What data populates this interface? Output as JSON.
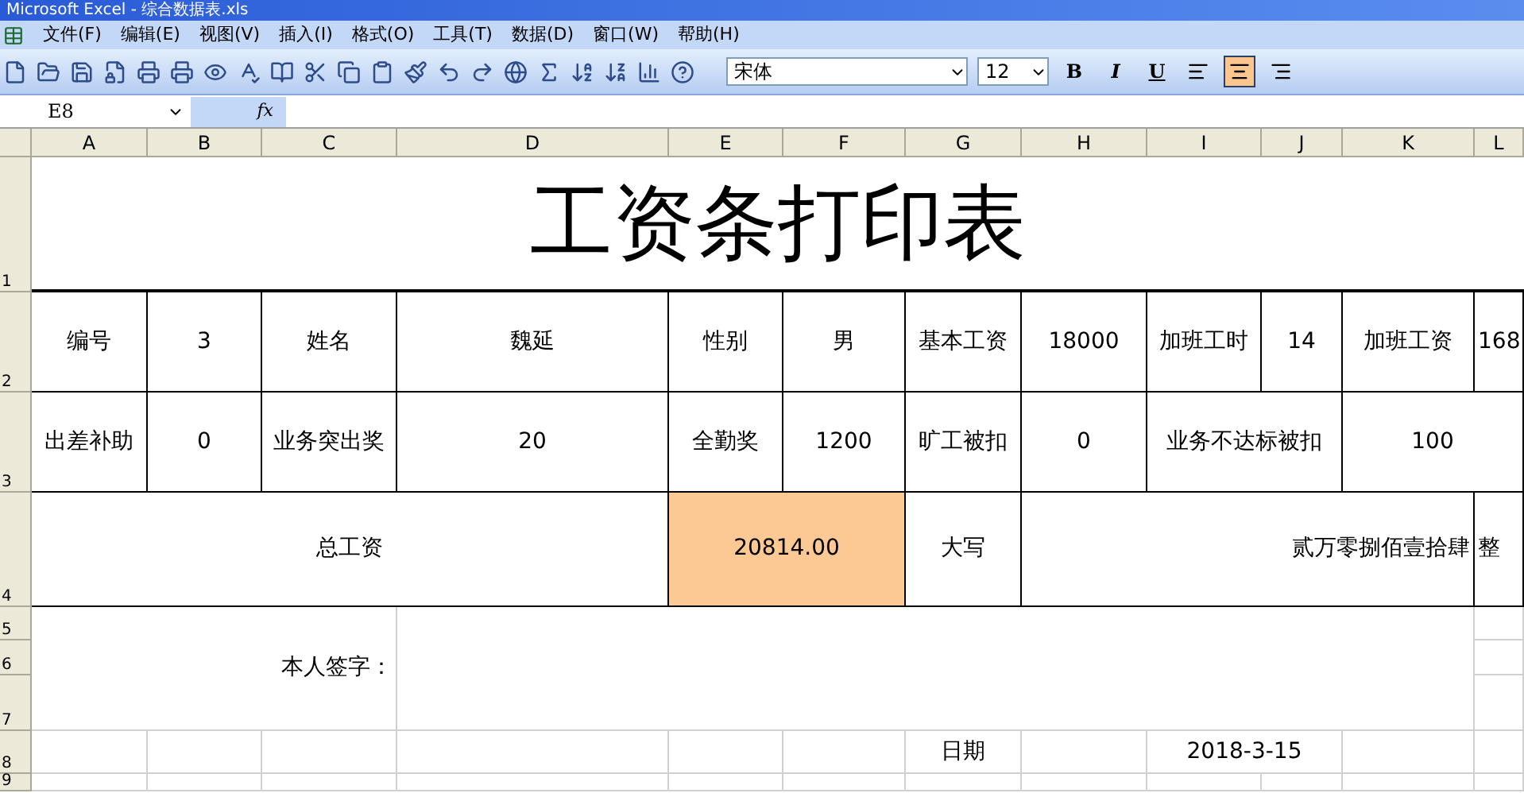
{
  "window": {
    "title": "Microsoft Excel - 综合数据表.xls"
  },
  "menu": [
    "文件(F)",
    "编辑(E)",
    "视图(V)",
    "插入(I)",
    "格式(O)",
    "工具(T)",
    "数据(D)",
    "窗口(W)",
    "帮助(H)"
  ],
  "toolbar": {
    "font": "宋体",
    "size": "12",
    "format_buttons": [
      {
        "label": "B",
        "kind": "bold",
        "selected": false
      },
      {
        "label": "I",
        "kind": "italic",
        "selected": false
      },
      {
        "label": "U",
        "kind": "underline",
        "selected": false
      }
    ],
    "align_buttons": [
      {
        "kind": "left",
        "selected": false
      },
      {
        "kind": "center",
        "selected": true
      },
      {
        "kind": "right",
        "selected": false
      }
    ]
  },
  "formula_bar": {
    "name_box": "E8",
    "fx": "fx"
  },
  "columns": [
    "A",
    "B",
    "C",
    "D",
    "E",
    "F",
    "G",
    "H",
    "I",
    "J",
    "K",
    "L"
  ],
  "rows": [
    "1",
    "2",
    "3",
    "4",
    "5",
    "6",
    "7",
    "8",
    "9"
  ],
  "sheet": {
    "title": "工资条打印表",
    "cells": [
      {
        "text": "编号"
      },
      {
        "text": "3"
      },
      {
        "text": "姓名"
      },
      {
        "text": "魏延"
      },
      {
        "text": "性别"
      },
      {
        "text": "男"
      },
      {
        "text": "基本工资"
      },
      {
        "text": "18000"
      },
      {
        "text": "加班工时"
      },
      {
        "text": "14"
      },
      {
        "text": "加班工资"
      },
      {
        "text": "168"
      },
      {
        "text": "出差补助"
      },
      {
        "text": "0"
      },
      {
        "text": "业务突出奖"
      },
      {
        "text": "20"
      },
      {
        "text": "全勤奖"
      },
      {
        "text": "1200"
      },
      {
        "text": "旷工被扣"
      },
      {
        "text": "0"
      },
      {
        "text": "业务不达标被扣"
      },
      {
        "text": "100"
      },
      {
        "text": "总工资"
      },
      {
        "text": "20814.00"
      },
      {
        "text": "大写"
      },
      {
        "text": "贰万零捌佰壹拾肆"
      },
      {
        "text": "整"
      },
      {
        "text": "本人签字："
      },
      {
        "text": "日期"
      },
      {
        "text": "2018-3-15"
      }
    ]
  }
}
